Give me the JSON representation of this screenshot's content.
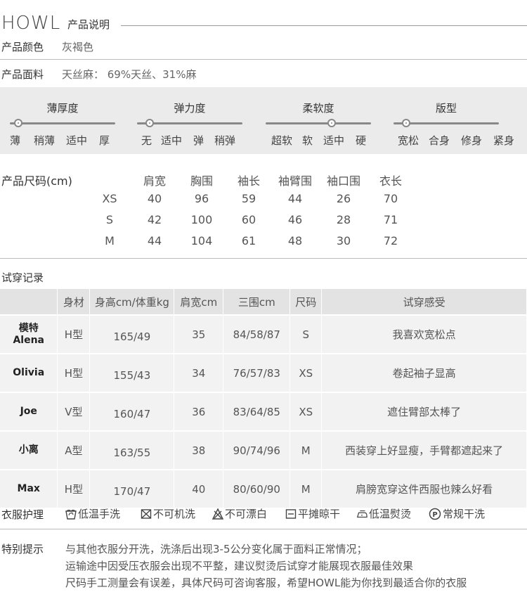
{
  "header": {
    "brand": "HOWL",
    "subtitle": "产品说明"
  },
  "color": {
    "label": "产品颜色",
    "value": "灰褐色"
  },
  "fabric": {
    "label": "产品面料",
    "value": "天丝麻： 69%天丝、31%麻"
  },
  "scales": [
    {
      "title": "薄厚度",
      "options": [
        "薄",
        "稍薄",
        "适中",
        "厚"
      ],
      "selected_index": 0
    },
    {
      "title": "弹力度",
      "options": [
        "无",
        "适中",
        "弹",
        "稍弹"
      ],
      "selected_index": 0
    },
    {
      "title": "柔软度",
      "options": [
        "超软",
        "软",
        "适中",
        "硬"
      ],
      "selected_index": 2
    },
    {
      "title": "版型",
      "options": [
        "宽松",
        "合身",
        "修身",
        "紧身"
      ],
      "selected_index": 0
    }
  ],
  "size_chart": {
    "label": "产品尺码(cm)",
    "headers": [
      "肩宽",
      "胸围",
      "袖长",
      "袖臂围",
      "袖口围",
      "衣长"
    ],
    "rows": [
      {
        "size": "XS",
        "values": [
          "40",
          "96",
          "59",
          "44",
          "26",
          "70"
        ]
      },
      {
        "size": "S",
        "values": [
          "42",
          "100",
          "60",
          "46",
          "28",
          "71"
        ]
      },
      {
        "size": "M",
        "values": [
          "44",
          "104",
          "61",
          "48",
          "30",
          "72"
        ]
      }
    ]
  },
  "tryon": {
    "label": "试穿记录",
    "headers": [
      "",
      "身材",
      "身高cm/体重kg",
      "肩宽cm",
      "三围cm",
      "尺码",
      "试穿感受"
    ],
    "rows": [
      {
        "name": "模特\nAlena",
        "name_line1": "模特",
        "name_line2": "Alena",
        "body": "H型",
        "hw": "165/49",
        "shoulder": "35",
        "bwh": "84/58/87",
        "size": "S",
        "feeling": "我喜欢宽松点"
      },
      {
        "name_line1": "Olivia",
        "name_line2": "",
        "body": "H型",
        "hw": "155/43",
        "shoulder": "34",
        "bwh": "76/57/83",
        "size": "XS",
        "feeling": "卷起袖子显高"
      },
      {
        "name_line1": "Joe",
        "name_line2": "",
        "body": "V型",
        "hw": "160/47",
        "shoulder": "36",
        "bwh": "83/64/85",
        "size": "XS",
        "feeling": "遮住臂部太棒了"
      },
      {
        "name_line1": "小离",
        "name_line2": "",
        "body": "A型",
        "hw": "163/55",
        "shoulder": "38",
        "bwh": "90/74/96",
        "size": "M",
        "feeling": "西装穿上好显瘦，手臂都遮起来了"
      },
      {
        "name_line1": "Max",
        "name_line2": "",
        "body": "H型",
        "hw": "170/47",
        "shoulder": "40",
        "bwh": "80/60/90",
        "size": "M",
        "feeling": "肩膀宽穿这件西服也辣么好看"
      }
    ]
  },
  "care": {
    "label": "衣服护理",
    "items": [
      {
        "icon": "hand-wash-icon",
        "text": "低温手洗"
      },
      {
        "icon": "no-machine-wash-icon",
        "text": "不可机洗"
      },
      {
        "icon": "no-bleach-icon",
        "text": "不可漂白"
      },
      {
        "icon": "flat-dry-icon",
        "text": "平摊晾干"
      },
      {
        "icon": "low-iron-icon",
        "text": "低温熨烫"
      },
      {
        "icon": "dry-clean-icon",
        "text": "常规干洗"
      }
    ]
  },
  "notes": {
    "label": "特别提示",
    "lines": [
      "与其他衣服分开洗，洗涤后出现3-5公分变化属于面料正常情况；",
      "运输途中因受压衣服会出现不平整，建议熨烫后试穿才能展现衣服最佳效果",
      "尺码手工测量会有误差，具体尺码可咨询客服，希望HOWL能为你找到最适合你的衣服"
    ]
  }
}
